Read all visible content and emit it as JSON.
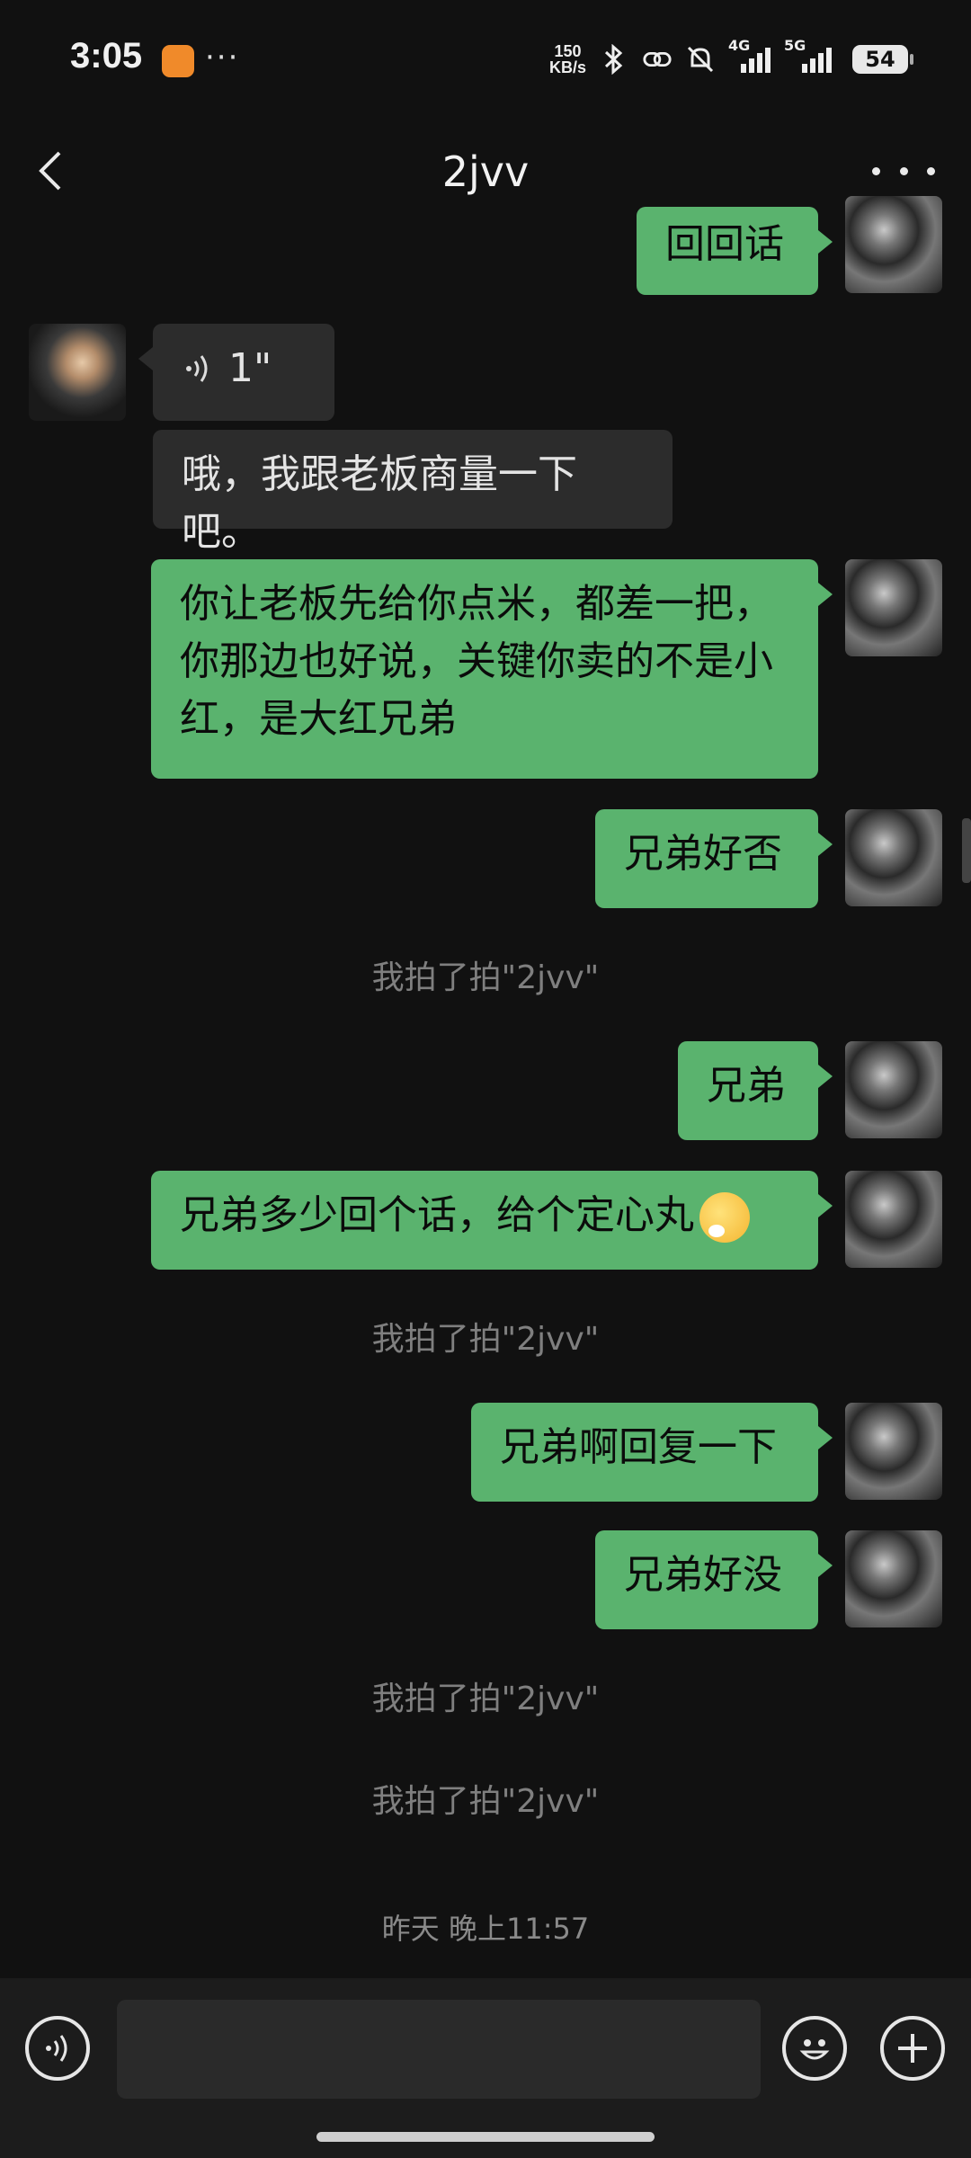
{
  "status_bar": {
    "time": "3:05",
    "net_speed_value": "150",
    "net_speed_unit": "KB/s",
    "signal_4g": "4G",
    "signal_5g": "5G",
    "battery": "54"
  },
  "header": {
    "title": "2jvv"
  },
  "messages": [
    {
      "side": "me",
      "text": "回回话"
    },
    {
      "side": "other",
      "type": "voice",
      "text": "1\""
    },
    {
      "side": "other",
      "text": "哦，我跟老板商量一下吧。"
    },
    {
      "side": "me",
      "text": "你让老板先给你点米，都差一把，你那边也好说，关键你卖的不是小红，是大红兄弟"
    },
    {
      "side": "me",
      "text": "兄弟好否"
    },
    {
      "side": "system",
      "text": "我拍了拍\"2jvv\""
    },
    {
      "side": "me",
      "text": "兄弟"
    },
    {
      "side": "me",
      "text": "兄弟多少回个话，给个定心丸"
    },
    {
      "side": "system",
      "text": "我拍了拍\"2jvv\""
    },
    {
      "side": "me",
      "text": "兄弟啊回复一下"
    },
    {
      "side": "me",
      "text": "兄弟好没"
    },
    {
      "side": "system",
      "text": "我拍了拍\"2jvv\""
    },
    {
      "side": "system",
      "text": "我拍了拍\"2jvv\""
    },
    {
      "side": "timestamp",
      "text": "昨天 晚上11:57"
    }
  ],
  "input_bar": {
    "icons": [
      "voice-icon",
      "emoji-icon",
      "plus-icon"
    ],
    "placeholder": ""
  },
  "colors": {
    "background": "#111111",
    "my_bubble": "#5ab36e",
    "other_bubble": "#2c2c2c",
    "system_text": "#7f7f7f"
  }
}
